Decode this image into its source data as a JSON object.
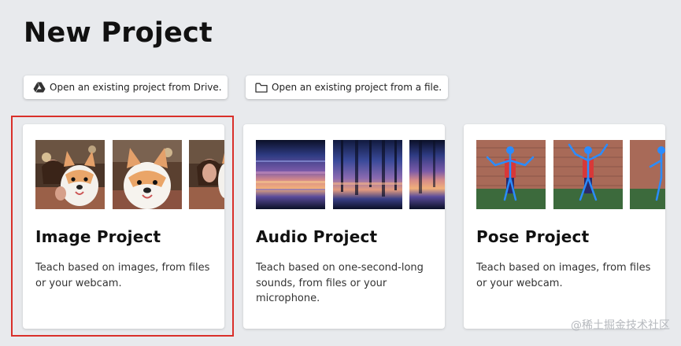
{
  "page": {
    "title": "New Project",
    "watermark": "@稀土掘金技术社区"
  },
  "open_buttons": {
    "drive": {
      "label": "Open an existing project from Drive.",
      "icon": "google-drive-icon"
    },
    "file": {
      "label": "Open an existing project from a file.",
      "icon": "folder-icon"
    }
  },
  "cards": [
    {
      "title": "Image Project",
      "description": "Teach based on images, from files or your webcam.",
      "selected": true,
      "thumbnails": [
        "person-holding-corgi-plush-photo",
        "corgi-plush-closeup-photo",
        "person-holding-corgi-plush-photo"
      ]
    },
    {
      "title": "Audio Project",
      "description": "Teach based on one-second-long sounds, from files or your microphone.",
      "selected": false,
      "thumbnails": [
        "audio-spectrogram",
        "audio-spectrogram",
        "audio-spectrogram"
      ]
    },
    {
      "title": "Pose Project",
      "description": "Teach based on images, from files or your webcam.",
      "selected": false,
      "thumbnails": [
        "pose-skeleton-photo",
        "pose-skeleton-photo",
        "pose-skeleton-photo"
      ]
    }
  ],
  "colors": {
    "background": "#e8eaed",
    "card": "#ffffff",
    "selection_outline": "#d9302a"
  }
}
